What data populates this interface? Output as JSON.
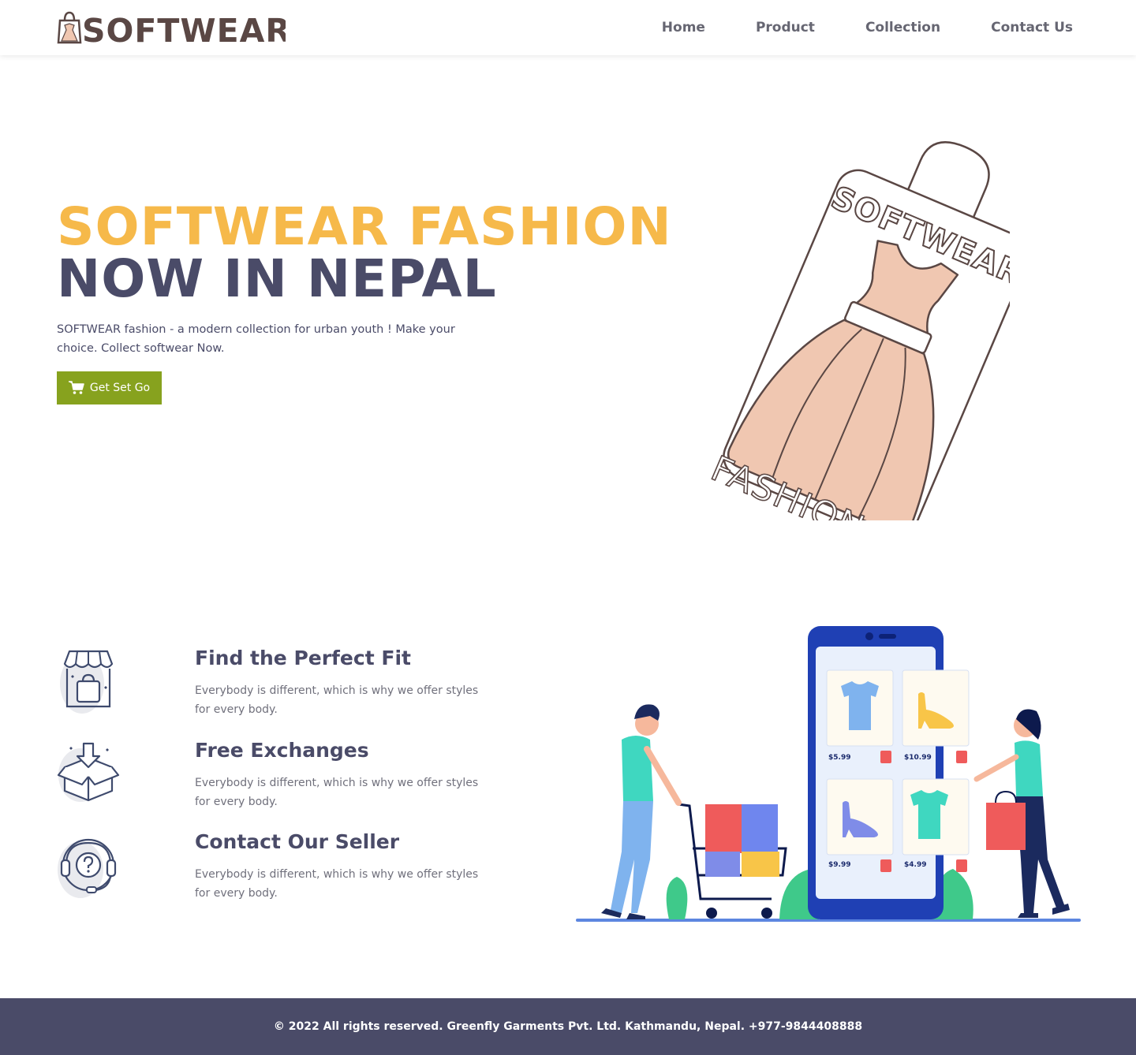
{
  "brand": {
    "logo_text": "SOFTWEAR",
    "colors": {
      "accent_yellow": "#f6b94a",
      "dark_slate": "#4a4b68",
      "cta_green": "#87a21e",
      "logo_brown": "#5a4744",
      "dress_peach": "#f0c7b1"
    }
  },
  "nav": {
    "items": [
      {
        "label": "Home"
      },
      {
        "label": "Product"
      },
      {
        "label": "Collection"
      },
      {
        "label": "Contact Us"
      }
    ]
  },
  "hero": {
    "title_line1": "SOFTWEAR FASHION",
    "title_line2": "NOW IN NEPAL",
    "description": "SOFTWEAR fashion - a modern collection for urban youth ! Make your choice. Collect softwear Now.",
    "cta_label": "Get Set Go",
    "cta_icon": "shopping-cart-icon",
    "tag_text_top": "SOFTWEAR",
    "tag_text_bottom": "FASHION"
  },
  "features": [
    {
      "title": "Find the Perfect Fit",
      "text": "Everybody is different, which is why we offer styles for every body.",
      "icon": "storefront-icon"
    },
    {
      "title": "Free Exchanges",
      "text": "Everybody is different, which is why we offer styles for every body.",
      "icon": "box-download-icon"
    },
    {
      "title": "Contact Our Seller",
      "text": "Everybody is different, which is why we offer styles for every body.",
      "icon": "headset-support-icon"
    }
  ],
  "shop_illustration": {
    "prices": [
      "$5.99",
      "$10.99",
      "$9.99",
      "$4.99"
    ]
  },
  "footer": {
    "text": "© 2022 All rights reserved. Greenfly Garments Pvt. Ltd. Kathmandu, Nepal. +977-9844408888"
  }
}
